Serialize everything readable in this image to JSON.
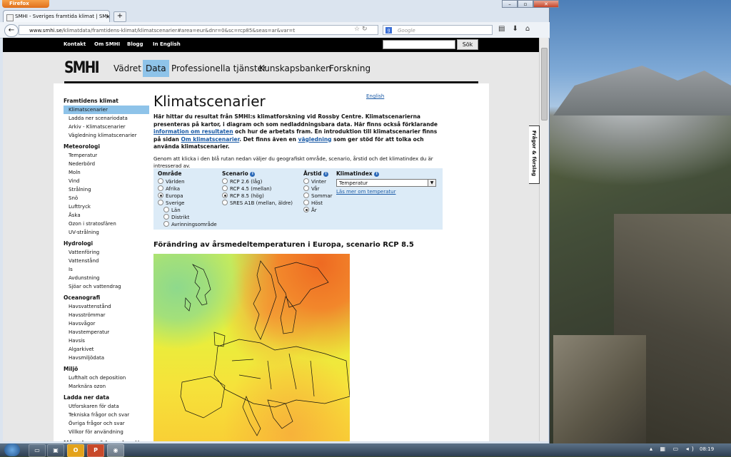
{
  "browser": {
    "app_button": "Firefox",
    "tab_title": "SMHI - Sveriges framtida klimat | SMHI",
    "url_host": "www.smhi.se",
    "url_path": "/klimatdata/framtidens-klimat/klimatscenarier#area=eur&dnr=0&sc=rcp85&seas=ar&var=t",
    "search_placeholder": "Google",
    "window_controls": [
      "–",
      "▫",
      "✕"
    ]
  },
  "topbar": {
    "links": [
      "Kontakt",
      "Om SMHI",
      "Blogg",
      "In English"
    ],
    "search_button": "Sök"
  },
  "site": {
    "logo": "SMHI",
    "nav": [
      "Vädret",
      "Data",
      "Professionella tjänster",
      "Kunskapsbanken",
      "Forskning"
    ],
    "active_nav": "Data",
    "side_tab": "Frågor & förslag"
  },
  "sidebar": {
    "groups": [
      {
        "title": "Framtidens klimat",
        "items": [
          "Klimatscenarier",
          "Ladda ner scenariodata",
          "Arkiv - Klimatscenarier",
          "Vägledning klimatscenarier"
        ]
      },
      {
        "title": "Meteorologi",
        "items": [
          "Temperatur",
          "Nederbörd",
          "Moln",
          "Vind",
          "Strålning",
          "Snö",
          "Lufttryck",
          "Åska",
          "Ozon i stratosfären",
          "UV-strålning"
        ]
      },
      {
        "title": "Hydrologi",
        "items": [
          "Vattenföring",
          "Vattenstånd",
          "Is",
          "Avdunstning",
          "Sjöar och vattendrag"
        ]
      },
      {
        "title": "Oceanografi",
        "items": [
          "Havsvattenstånd",
          "Havsströmmar",
          "Havsvågor",
          "Havstemperatur",
          "Havsis",
          "Algarkivet",
          "Havsmiljödata"
        ]
      },
      {
        "title": "Miljö",
        "items": [
          "Lufthalt och deposition",
          "Marknära ozon"
        ]
      },
      {
        "title": "Ladda ner data",
        "items": [
          "Utforskaren för data",
          "Tekniska frågor och svar",
          "Övriga frågor och svar",
          "Villkor för användning"
        ]
      },
      {
        "title": "Månadens väder och vatten",
        "items": []
      }
    ],
    "active_item": "Klimatscenarier"
  },
  "main": {
    "english_link": "English",
    "title": "Klimatscenarier",
    "intro_1": "Här hittar du resultat från SMHI:s klimatforskning vid Rossby Centre. Klimatscenarierna presenteras på kartor, i diagram och som nedladdningsbara data. Här finns också förklarande ",
    "intro_link_1": "information om resultaten",
    "intro_2": " och hur de arbetats fram. En introduktion till klimatscenarier finns på sidan ",
    "intro_link_2": "Om klimatscenarier",
    "intro_3": ". Det finns även en ",
    "intro_link_3": "vägledning",
    "intro_4": " som ger stöd för att tolka och använda klimatscenarier.",
    "instructions": "Genom att klicka i den blå rutan nedan väljer du geografiskt område, scenario, årstid och det klimatindex du är intresserad av.",
    "map_title": "Förändring av årsmedeltemperaturen i Europa, scenario RCP 8.5"
  },
  "selector": {
    "area": {
      "label": "Område",
      "options": [
        "Världen",
        "Afrika",
        "Europa",
        "Sverige"
      ],
      "sub_options": [
        "Län",
        "Distrikt",
        "Avrinningsområde"
      ],
      "selected": "Europa"
    },
    "scenario": {
      "label": "Scenario",
      "options": [
        "RCP 2.6 (låg)",
        "RCP 4.5 (mellan)",
        "RCP 8.5 (hög)",
        "SRES A1B (mellan, äldre)"
      ],
      "selected": "RCP 8.5 (hög)"
    },
    "season": {
      "label": "Årstid",
      "options": [
        "Vinter",
        "Vår",
        "Sommar",
        "Höst",
        "År"
      ],
      "selected": "År"
    },
    "index": {
      "label": "Klimatindex",
      "value": "Temperatur",
      "link": "Läs mer om temperatur"
    }
  },
  "taskbar": {
    "clock": "08:19"
  }
}
